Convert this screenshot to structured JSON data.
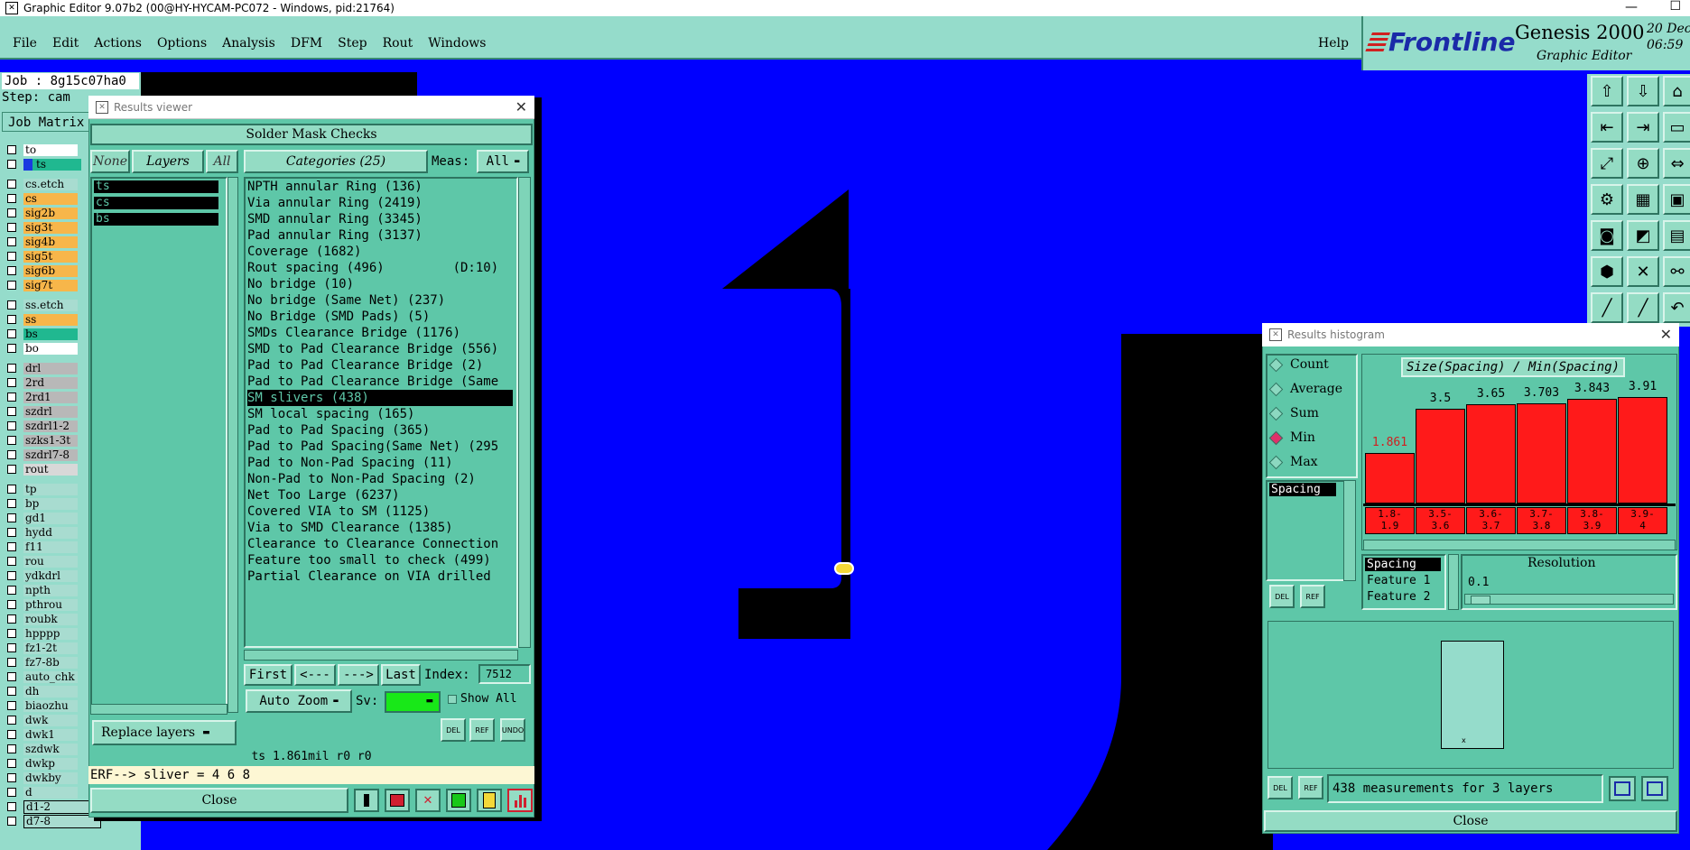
{
  "window": {
    "title": "Graphic Editor 9.07b2 (00@HY-HYCAM-PC072 - Windows, pid:21764)"
  },
  "menu": {
    "items": [
      "File",
      "Edit",
      "Actions",
      "Options",
      "Analysis",
      "DFM",
      "Step",
      "Rout",
      "Windows"
    ],
    "help": "Help"
  },
  "brand": {
    "logo": "Frontline",
    "product": "Genesis 2000",
    "subtitle": "Graphic Editor",
    "date": "20 Dec",
    "time": "06:59"
  },
  "job": {
    "job_label": "Job : 8g15c07ha0",
    "step_label": "Step: cam",
    "matrix_label": "Job Matrix"
  },
  "layers": [
    {
      "name": "to",
      "color": "#ffffff"
    },
    {
      "name": "ts",
      "color": "#20b890"
    },
    {
      "name": "cs.etch",
      "color": "#a8dcd0"
    },
    {
      "name": "cs",
      "color": "#f7b64a"
    },
    {
      "name": "sig2b",
      "color": "#f7b64a"
    },
    {
      "name": "sig3t",
      "color": "#f7b64a"
    },
    {
      "name": "sig4b",
      "color": "#f7b64a"
    },
    {
      "name": "sig5t",
      "color": "#f7b64a"
    },
    {
      "name": "sig6b",
      "color": "#f7b64a"
    },
    {
      "name": "sig7t",
      "color": "#f7b64a"
    },
    {
      "name": "ss.etch",
      "color": "#a8dcd0"
    },
    {
      "name": "ss",
      "color": "#f7b64a"
    },
    {
      "name": "bs",
      "color": "#20b890"
    },
    {
      "name": "bo",
      "color": "#ffffff"
    },
    {
      "name": "drl",
      "color": "#b8b8b8"
    },
    {
      "name": "2rd",
      "color": "#b8b8b8"
    },
    {
      "name": "2rd1",
      "color": "#b8b8b8"
    },
    {
      "name": "szdrl",
      "color": "#b8b8b8"
    },
    {
      "name": "szdrl1-2",
      "color": "#b8b8b8"
    },
    {
      "name": "szks1-3t",
      "color": "#b8b8b8"
    },
    {
      "name": "szdrl7-8",
      "color": "#b8b8b8"
    },
    {
      "name": "rout",
      "color": "#d8d8d8"
    },
    {
      "name": "tp",
      "color": "#a8dcd0"
    },
    {
      "name": "bp",
      "color": "#a8dcd0"
    },
    {
      "name": "gd1",
      "color": "#a8dcd0"
    },
    {
      "name": "hydd",
      "color": "#a8dcd0"
    },
    {
      "name": "f11",
      "color": "#a8dcd0"
    },
    {
      "name": "rou",
      "color": "#a8dcd0"
    },
    {
      "name": "ydkdrl",
      "color": "#a8dcd0"
    },
    {
      "name": "npth",
      "color": "#a8dcd0"
    },
    {
      "name": "pthrou",
      "color": "#a8dcd0"
    },
    {
      "name": "roubk",
      "color": "#a8dcd0"
    },
    {
      "name": "hpppp",
      "color": "#a8dcd0"
    },
    {
      "name": "fz1-2t",
      "color": "#a8dcd0"
    },
    {
      "name": "fz7-8b",
      "color": "#a8dcd0"
    },
    {
      "name": "auto_chk",
      "color": "#a8dcd0"
    },
    {
      "name": "dh",
      "color": "#a8dcd0"
    },
    {
      "name": "biaozhu",
      "color": "#a8dcd0"
    },
    {
      "name": "dwk",
      "color": "#a8dcd0"
    },
    {
      "name": "dwk1",
      "color": "#a8dcd0"
    },
    {
      "name": "szdwk",
      "color": "#a8dcd0"
    },
    {
      "name": "dwkp",
      "color": "#a8dcd0"
    },
    {
      "name": "dwkby",
      "color": "#a8dcd0"
    },
    {
      "name": "d",
      "color": "#a8dcd0"
    },
    {
      "name": "d1-2",
      "color": "#a8dcd0"
    },
    {
      "name": "d7-8",
      "color": "#a8dcd0"
    }
  ],
  "results_viewer": {
    "title": "Results viewer",
    "header": "Solder Mask Checks",
    "none_btn": "None",
    "layers_btn": "Layers",
    "all_btn": "All",
    "categories_btn": "Categories (25)",
    "meas_label": "Meas:",
    "meas_value": "All",
    "selected_layers": [
      "ts",
      "cs",
      "bs"
    ],
    "categories": [
      "NPTH annular Ring (136)",
      "Via annular Ring (2419)",
      "SMD annular Ring (3345)",
      "Pad annular Ring (3137)",
      "Coverage (1682)",
      "Rout spacing (496)         (D:10)",
      "No bridge (10)",
      "No bridge (Same Net) (237)",
      "No Bridge (SMD Pads) (5)",
      "SMDs Clearance Bridge (1176)",
      "SMD to Pad Clearance Bridge (556)",
      "Pad to Pad Clearance Bridge (2)",
      "Pad to Pad Clearance Bridge (Same",
      "SM slivers (438)",
      "SM local spacing (165)",
      "Pad to Pad Spacing (365)",
      "Pad to Pad Spacing(Same Net) (295",
      "Pad to Non-Pad Spacing (11)",
      "Non-Pad to Non-Pad Spacing (2)",
      "Net Too Large (6237)",
      "Covered VIA to SM (1125)",
      "Via to SMD Clearance (1385)",
      "Clearance to Clearance Connection",
      "Feature too small to check (499)",
      "Partial Clearance on VIA drilled"
    ],
    "selected_category_index": 13,
    "nav": {
      "first": "First",
      "prev": "<---",
      "next": "--->",
      "last": "Last",
      "index_label": "Index:",
      "index_value": "7512"
    },
    "auto_zoom": "Auto Zoom",
    "sv_label": "Sv:",
    "show_all": "Show All",
    "replace_layers": "Replace layers",
    "icons": {
      "del": "DEL",
      "ref": "REF",
      "undo": "UNDO"
    },
    "status": "ts 1.861mil  r0  r0",
    "erf": "ERF--> sliver = 4 6 8",
    "close": "Close"
  },
  "histogram": {
    "title": "Results histogram",
    "radio_options": [
      "Count",
      "Average",
      "Sum",
      "Min",
      "Max"
    ],
    "selected_radio": "Min",
    "measure_list": [
      "Spacing"
    ],
    "chart_title": "Size(Spacing) / Min(Spacing)",
    "lower_list": [
      "Spacing",
      "Feature 1",
      "Feature 2"
    ],
    "resolution_label": "Resolution",
    "resolution_value": "0.1",
    "summary": "438 measurements for 3 layers",
    "close": "Close",
    "del": "DEL",
    "ref": "REF"
  },
  "chart_data": {
    "type": "bar",
    "title": "Size(Spacing) / Min(Spacing)",
    "categories": [
      "1.8-1.9",
      "3.5-3.6",
      "3.6-3.7",
      "3.7-3.8",
      "3.8-3.9",
      "3.9-4"
    ],
    "values": [
      1.861,
      3.5,
      3.65,
      3.703,
      3.843,
      3.91
    ],
    "value_labels": [
      "1.861",
      "3.5",
      "3.65",
      "3.703",
      "3.843",
      "3.91"
    ],
    "category_lines": [
      [
        "1.8-",
        "1.9"
      ],
      [
        "3.5-",
        "3.6"
      ],
      [
        "3.6-",
        "3.7"
      ],
      [
        "3.7-",
        "3.8"
      ],
      [
        "3.8-",
        "3.9"
      ],
      [
        "3.9-",
        "4"
      ]
    ],
    "highlight_index": 0,
    "bar_color": "#ff1a1a",
    "ylim": [
      0,
      4
    ]
  }
}
